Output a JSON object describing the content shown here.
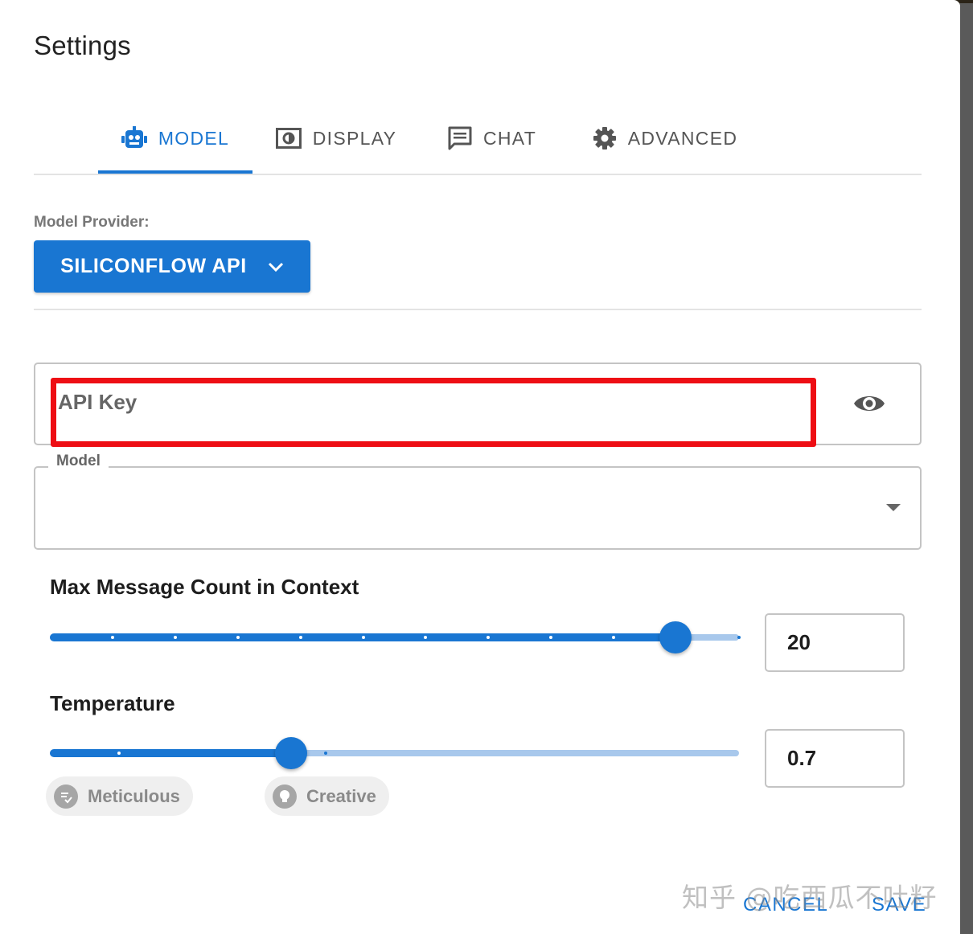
{
  "dialog": {
    "title": "Settings"
  },
  "tabs": [
    {
      "label": "MODEL",
      "icon": "robot-icon",
      "active": true
    },
    {
      "label": "DISPLAY",
      "icon": "display-icon",
      "active": false
    },
    {
      "label": "CHAT",
      "icon": "chat-icon",
      "active": false
    },
    {
      "label": "ADVANCED",
      "icon": "gear-icon",
      "active": false
    }
  ],
  "model_provider": {
    "label": "Model Provider:",
    "value": "SILICONFLOW API"
  },
  "api_key": {
    "label": "API Key",
    "value": ""
  },
  "model": {
    "label": "Model",
    "value": ""
  },
  "max_message_count": {
    "label": "Max Message Count in Context",
    "value": "20",
    "slider_fraction": 0.908
  },
  "temperature": {
    "label": "Temperature",
    "value": "0.7",
    "slider_fraction": 0.35,
    "chips": [
      {
        "label": "Meticulous",
        "icon": "meticulous-icon"
      },
      {
        "label": "Creative",
        "icon": "lightbulb-icon"
      }
    ]
  },
  "footer": {
    "cancel_label": "CANCEL",
    "save_label": "SAVE"
  },
  "watermark": "知乎 @吃西瓜不吐籽",
  "colors": {
    "accent": "#1976d2",
    "highlight_box": "#ee0e14"
  }
}
